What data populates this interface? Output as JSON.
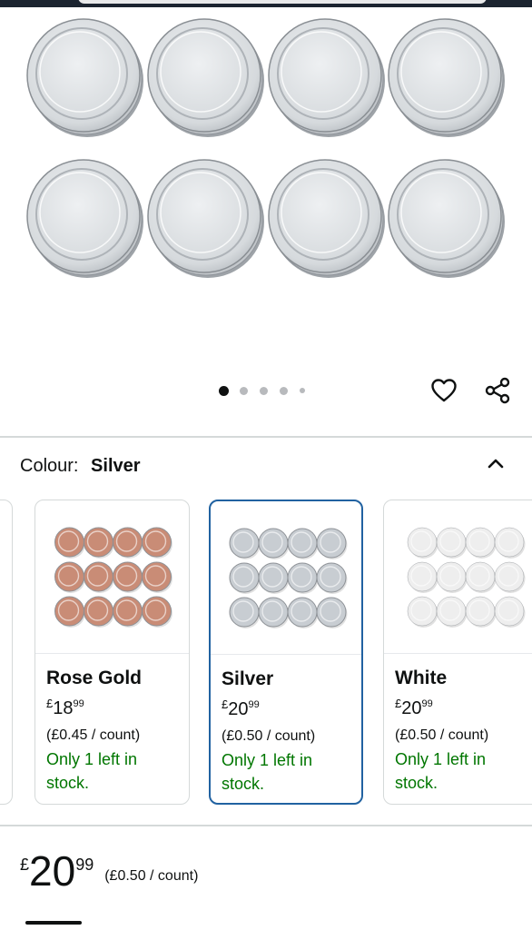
{
  "product": {
    "gallery": {
      "image_count": 5,
      "active_index": 0,
      "icon": "lid-image"
    },
    "actions": {
      "wishlist_icon": "heart-icon",
      "share_icon": "share-icon"
    }
  },
  "variation": {
    "label": "Colour:",
    "selected": "Silver",
    "collapse_icon": "chevron-up-icon",
    "options": [
      {
        "name": "Rose Gold",
        "price_symbol": "£",
        "price_whole": "18",
        "price_fraction": "99",
        "unit_price": "(£0.45 / count)",
        "stock": "Only 1 left in stock.",
        "selected": false,
        "color": "#c98c76"
      },
      {
        "name": "Silver",
        "price_symbol": "£",
        "price_whole": "20",
        "price_fraction": "99",
        "unit_price": "(£0.50 / count)",
        "stock": "Only 1 left in stock.",
        "selected": true,
        "color": "#c8cdd2"
      },
      {
        "name": "White",
        "price_symbol": "£",
        "price_whole": "20",
        "price_fraction": "99",
        "unit_price": "(£0.50 / count)",
        "stock": "Only 1 left in stock.",
        "selected": false,
        "color": "#eeeeee"
      }
    ]
  },
  "buybox": {
    "price_symbol": "£",
    "price_whole": "20",
    "price_fraction": "99",
    "unit_price": "(£0.50 / count)"
  },
  "colors": {
    "stock_green": "#007600",
    "selected_border": "#2162a1",
    "text": "#0f1111"
  }
}
